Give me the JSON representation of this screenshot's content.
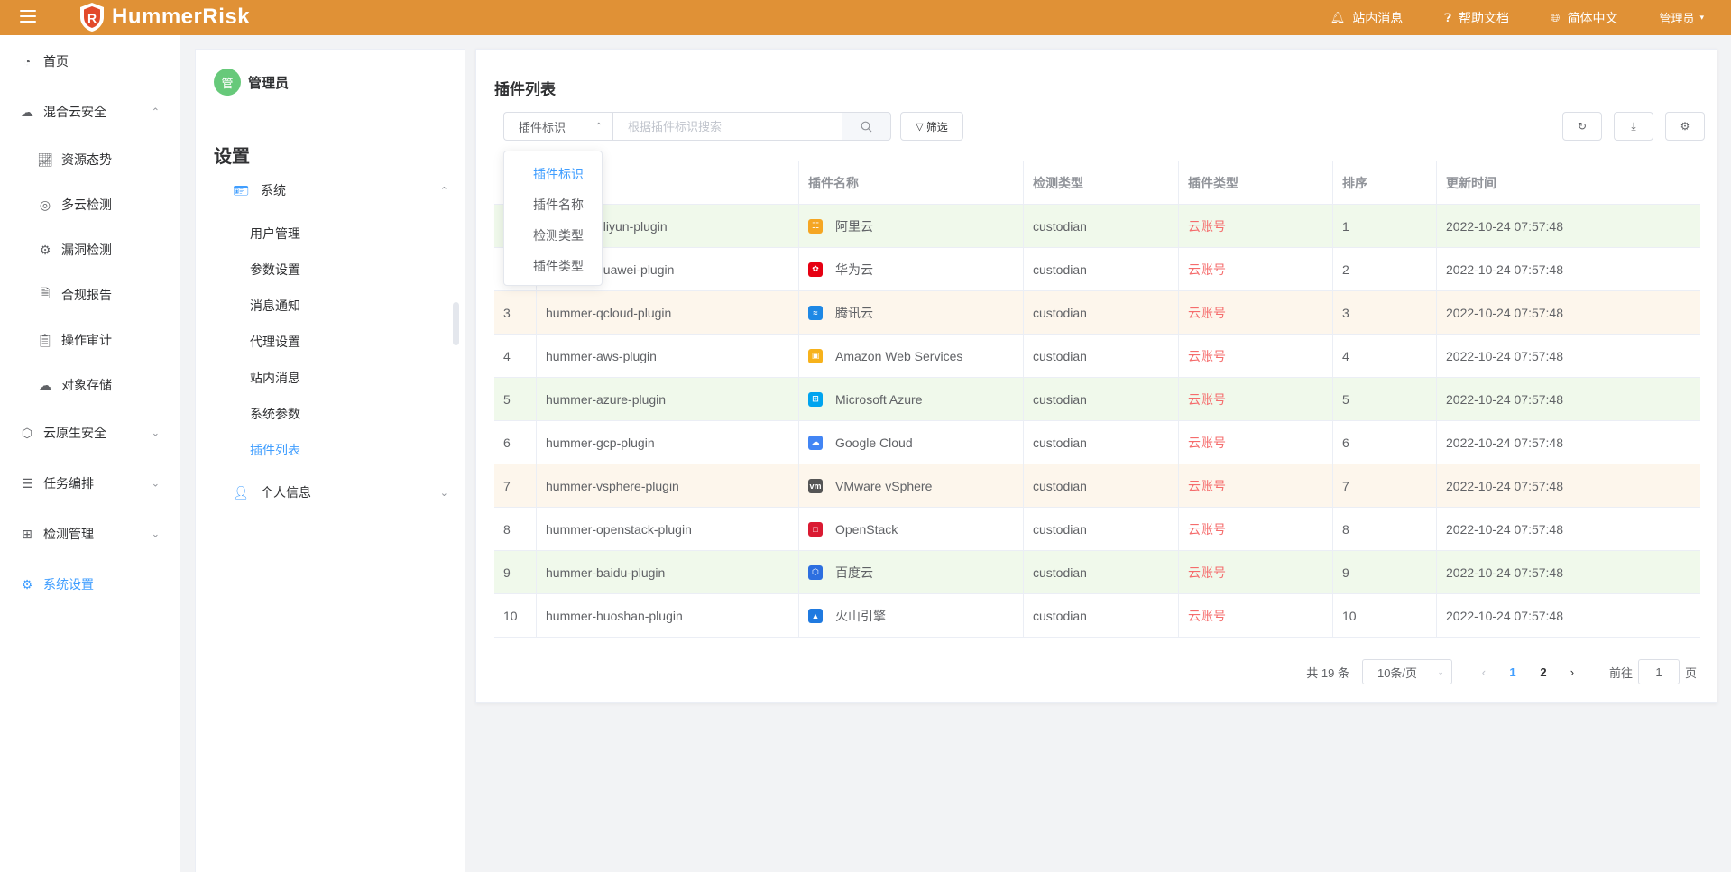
{
  "app": {
    "name": "HummerRisk",
    "brand_color": "#e09136",
    "accent_color": "#409eff"
  },
  "topbar": {
    "messages": "站内消息",
    "help": "帮助文档",
    "language": "简体中文",
    "user": "管理员"
  },
  "sidebar": {
    "items": [
      {
        "label": "首页",
        "icon": "pie-chart-icon"
      },
      {
        "label": "混合云安全",
        "icon": "cloud-icon"
      },
      {
        "label": "资源态势",
        "icon": "trend-chart-icon"
      },
      {
        "label": "多云检测",
        "icon": "scan-icon"
      },
      {
        "label": "漏洞检测",
        "icon": "bug-icon"
      },
      {
        "label": "合规报告",
        "icon": "report-icon"
      },
      {
        "label": "操作审计",
        "icon": "audit-icon"
      },
      {
        "label": "对象存储",
        "icon": "cloud-storage-icon"
      },
      {
        "label": "云原生安全",
        "icon": "cloud-native-icon"
      },
      {
        "label": "任务编排",
        "icon": "list-icon"
      },
      {
        "label": "检测管理",
        "icon": "grid-icon"
      },
      {
        "label": "系统设置",
        "icon": "gear-icon"
      }
    ]
  },
  "settings": {
    "avatar_text": "管",
    "user_name": "管理员",
    "title": "设置",
    "group_system": "系统",
    "items": [
      "用户管理",
      "参数设置",
      "消息通知",
      "代理设置",
      "站内消息",
      "系统参数",
      "插件列表"
    ],
    "group_personal": "个人信息"
  },
  "main": {
    "title": "插件列表",
    "search_field": "插件标识",
    "search_placeholder": "根据插件标识搜索",
    "filter_label": "筛选",
    "dropdown_options": [
      "插件标识",
      "插件名称",
      "检测类型",
      "插件类型"
    ],
    "columns": [
      "",
      "",
      "插件名称",
      "检测类型",
      "插件类型",
      "排序",
      "更新时间"
    ],
    "rows": [
      {
        "no": "1",
        "id": "hummer-aliyun-plugin",
        "name": "阿里云",
        "icon": "aliyun-icon",
        "detect": "custodian",
        "type": "云账号",
        "order": "1",
        "time": "2022-10-24 07:57:48"
      },
      {
        "no": "2",
        "id": "hummer-huawei-plugin",
        "name": "华为云",
        "icon": "huawei-icon",
        "detect": "custodian",
        "type": "云账号",
        "order": "2",
        "time": "2022-10-24 07:57:48"
      },
      {
        "no": "3",
        "id": "hummer-qcloud-plugin",
        "name": "腾讯云",
        "icon": "qcloud-icon",
        "detect": "custodian",
        "type": "云账号",
        "order": "3",
        "time": "2022-10-24 07:57:48"
      },
      {
        "no": "4",
        "id": "hummer-aws-plugin",
        "name": "Amazon Web Services",
        "icon": "aws-icon",
        "detect": "custodian",
        "type": "云账号",
        "order": "4",
        "time": "2022-10-24 07:57:48"
      },
      {
        "no": "5",
        "id": "hummer-azure-plugin",
        "name": "Microsoft Azure",
        "icon": "azure-icon",
        "detect": "custodian",
        "type": "云账号",
        "order": "5",
        "time": "2022-10-24 07:57:48"
      },
      {
        "no": "6",
        "id": "hummer-gcp-plugin",
        "name": "Google Cloud",
        "icon": "gcp-icon",
        "detect": "custodian",
        "type": "云账号",
        "order": "6",
        "time": "2022-10-24 07:57:48"
      },
      {
        "no": "7",
        "id": "hummer-vsphere-plugin",
        "name": "VMware vSphere",
        "icon": "vmware-icon",
        "detect": "custodian",
        "type": "云账号",
        "order": "7",
        "time": "2022-10-24 07:57:48"
      },
      {
        "no": "8",
        "id": "hummer-openstack-plugin",
        "name": "OpenStack",
        "icon": "openstack-icon",
        "detect": "custodian",
        "type": "云账号",
        "order": "8",
        "time": "2022-10-24 07:57:48"
      },
      {
        "no": "9",
        "id": "hummer-baidu-plugin",
        "name": "百度云",
        "icon": "baidu-icon",
        "detect": "custodian",
        "type": "云账号",
        "order": "9",
        "time": "2022-10-24 07:57:48"
      },
      {
        "no": "10",
        "id": "hummer-huoshan-plugin",
        "name": "火山引擎",
        "icon": "huoshan-icon",
        "detect": "custodian",
        "type": "云账号",
        "order": "10",
        "time": "2022-10-24 07:57:48"
      }
    ],
    "row_colors": [
      "#f0f9eb",
      "#ffffff",
      "#fdf6ec",
      "#ffffff"
    ]
  },
  "pagination": {
    "total": "共 19 条",
    "page_size": "10条/页",
    "pages": [
      "1",
      "2"
    ],
    "current_page": "1",
    "goto_label": "前往",
    "goto_value": "1",
    "page_suffix": "页"
  }
}
